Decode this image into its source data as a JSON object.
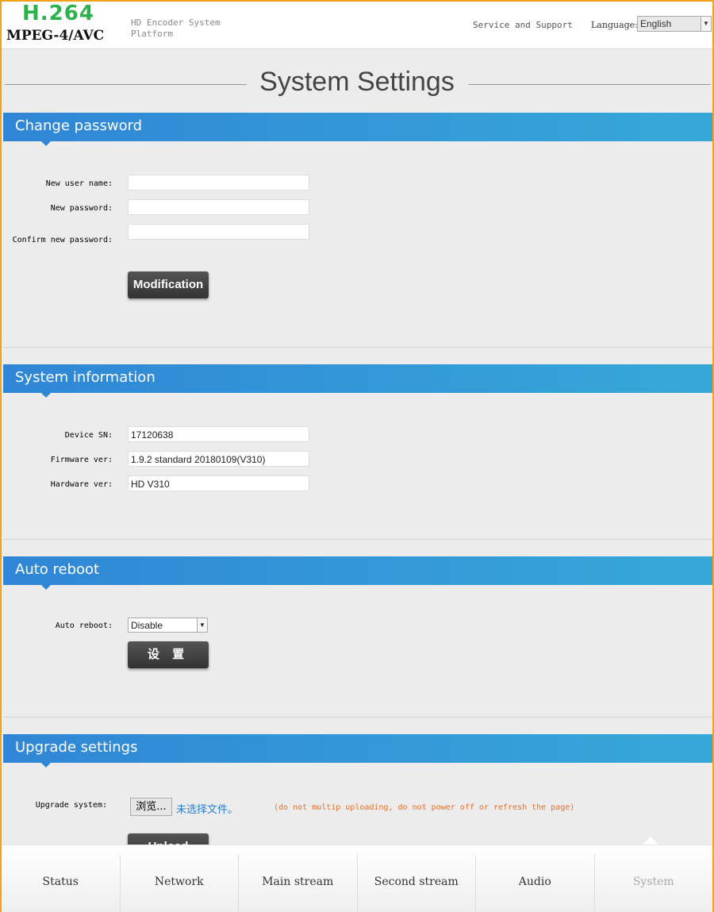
{
  "header": {
    "logo_top": "H.264",
    "logo_bottom": "MPEG-4/AVC",
    "subtitle": "HD Encoder System Platform",
    "support": "Service and Support",
    "language_label": "Language:",
    "language_value": "English"
  },
  "page_title": "System Settings",
  "change_password": {
    "title": "Change password",
    "user_label": "New user name:",
    "pass_label": "New password:",
    "confirm_label": "Confirm new password:",
    "user_value": "",
    "pass_value": "",
    "confirm_value": "",
    "button": "Modification"
  },
  "system_info": {
    "title": "System information",
    "sn_label": "Device SN:",
    "sn_value": "17120638",
    "fw_label": "Firmware ver:",
    "fw_value": "1.9.2 standard 20180109(V310)",
    "hw_label": "Hardware ver:",
    "hw_value": "HD V310"
  },
  "auto_reboot": {
    "title": "Auto reboot",
    "label": "Auto reboot:",
    "value": "Disable",
    "button": "设 置"
  },
  "upgrade": {
    "title": "Upgrade settings",
    "label": "Upgrade system:",
    "browse": "浏览...",
    "no_file": "未选择文件。",
    "warning": "(do not multip uploading, do not power off or refresh the page)",
    "button": "Upload",
    "second_label": ""
  },
  "nav": {
    "tabs": [
      "Status",
      "Network",
      "Main stream",
      "Second stream",
      "Audio",
      "System"
    ],
    "active": "System"
  },
  "colors": {
    "accent": "#2f86d6",
    "border": "#f4a21c",
    "warning": "#e8702a",
    "link": "#2a7fd4"
  }
}
